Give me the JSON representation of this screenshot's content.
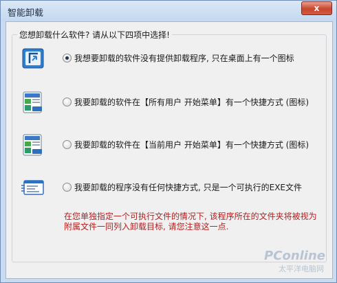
{
  "window": {
    "title": "智能卸载",
    "close_label": "x"
  },
  "prompt": "您想卸载什么软件? 请从以下四项中选择!",
  "options": [
    {
      "label": "我想要卸载的软件没有提供卸载程序, 只在桌面上有一个图标",
      "checked": true,
      "icon": "desktop-shortcut-icon"
    },
    {
      "label": "我要卸载的软件在【所有用户 开始菜单】有一个快捷方式 (图标)",
      "checked": false,
      "icon": "all-users-start-menu-icon"
    },
    {
      "label": "我要卸载的软件在【当前用户 开始菜单】有一个快捷方式 (图标)",
      "checked": false,
      "icon": "current-user-start-menu-icon"
    },
    {
      "label": "我要卸载的程序没有任何快捷方式, 只是一个可执行的EXE文件",
      "checked": false,
      "icon": "exe-file-icon"
    }
  ],
  "note": "在您单独指定一个可执行文件的情况下, 该程序所在的文件夹将被视为附属文件一同列入卸载目标, 请您注意这一点.",
  "watermark": {
    "logo": "PConline",
    "sub": "太平洋电脑网"
  },
  "colors": {
    "note_text": "#b02020",
    "title_bar": "#c4d8ef",
    "client_bg": "#f0f0f0"
  }
}
